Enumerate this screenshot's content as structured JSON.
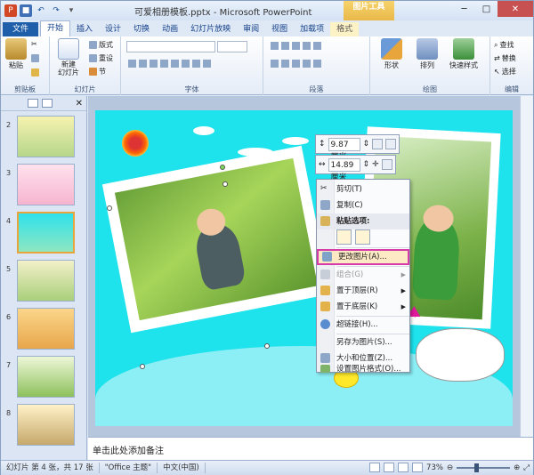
{
  "window": {
    "title": "可爱相册模板.pptx - Microsoft PowerPoint",
    "context_tool": "图片工具",
    "buttons": {
      "minimize": "─",
      "maximize": "□",
      "close": "✕"
    }
  },
  "tabs": [
    {
      "label": "文件"
    },
    {
      "label": "开始"
    },
    {
      "label": "插入"
    },
    {
      "label": "设计"
    },
    {
      "label": "切换"
    },
    {
      "label": "动画"
    },
    {
      "label": "幻灯片放映"
    },
    {
      "label": "审阅"
    },
    {
      "label": "视图"
    },
    {
      "label": "加载项"
    },
    {
      "label": "格式"
    }
  ],
  "ribbon": {
    "clipboard": {
      "label": "剪贴板",
      "paste": "粘贴"
    },
    "slides": {
      "label": "幻灯片",
      "new_slide": "新建\n幻灯片",
      "layout": "版式",
      "reset": "重设",
      "section": "节"
    },
    "font": {
      "label": "字体"
    },
    "paragraph": {
      "label": "段落"
    },
    "drawing": {
      "label": "绘图",
      "shapes": "形状",
      "arrange": "排列",
      "quick_styles": "快速样式"
    },
    "editing": {
      "label": "编辑",
      "find": "查找",
      "replace": "替换",
      "select": "选择"
    }
  },
  "slides_pane": {
    "thumbs": [
      {
        "num": "2"
      },
      {
        "num": "3"
      },
      {
        "num": "4"
      },
      {
        "num": "5"
      },
      {
        "num": "6"
      },
      {
        "num": "7"
      },
      {
        "num": "8"
      }
    ],
    "selected": "4"
  },
  "mini_toolbar": {
    "width": "9.87 厘米",
    "height": "14.89 厘米"
  },
  "context_menu": {
    "items": [
      {
        "label": "剪切(T)",
        "enabled": true
      },
      {
        "label": "复制(C)",
        "enabled": true
      },
      {
        "label": "粘贴选项:",
        "enabled": true
      },
      {
        "label": "更改图片(A)...",
        "enabled": true,
        "highlighted": true
      },
      {
        "label": "组合(G)",
        "enabled": false
      },
      {
        "label": "置于顶层(R)",
        "enabled": true
      },
      {
        "label": "置于底层(K)",
        "enabled": true
      },
      {
        "label": "超链接(H)...",
        "enabled": true
      },
      {
        "label": "另存为图片(S)...",
        "enabled": true
      },
      {
        "label": "大小和位置(Z)...",
        "enabled": true
      },
      {
        "label": "设置图片格式(O)...",
        "enabled": true
      }
    ]
  },
  "notes": {
    "placeholder": "单击此处添加备注"
  },
  "status": {
    "slide_info": "幻灯片 第 4 张，共 17 张",
    "theme": "\"Office 主题\"",
    "language": "中文(中国)",
    "zoom": "73%",
    "zoom_fraction": 0.73
  }
}
